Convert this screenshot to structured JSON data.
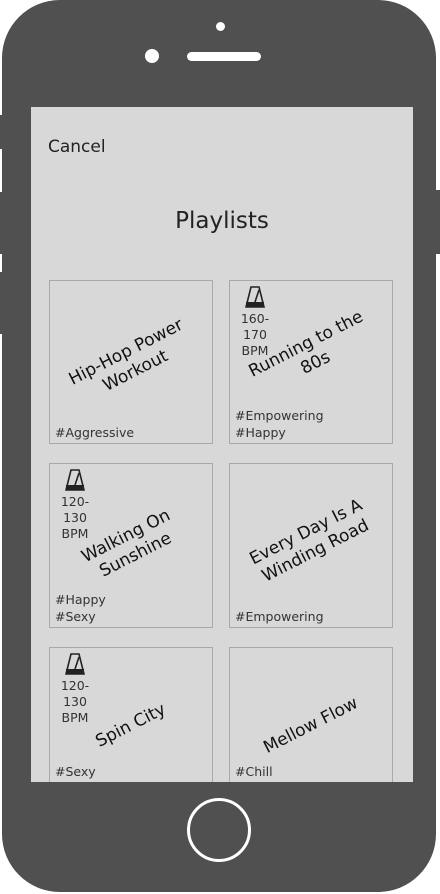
{
  "header": {
    "cancel_label": "Cancel",
    "title": "Playlists"
  },
  "playlists": [
    {
      "title": "Hip-Hop Power Workout",
      "bpm": "",
      "tags": [
        "#Aggressive"
      ]
    },
    {
      "title": "Running to the 80s",
      "bpm": "160-170 BPM",
      "tags": [
        "#Empowering",
        "#Happy"
      ]
    },
    {
      "title": "Walking On Sunshine",
      "bpm": "120-130 BPM",
      "tags": [
        "#Happy",
        "#Sexy"
      ]
    },
    {
      "title": "Every Day Is A Winding Road",
      "bpm": "",
      "tags": [
        "#Empowering"
      ]
    },
    {
      "title": "Spin City",
      "bpm": "120-130 BPM",
      "tags": [
        "#Sexy"
      ]
    },
    {
      "title": "Mellow Flow",
      "bpm": "",
      "tags": [
        "#Chill"
      ]
    }
  ],
  "icons": {
    "bpm_icon": "metronome-icon"
  },
  "colors": {
    "phone_frame": "#505050",
    "screen_bg": "#d8d8d8",
    "card_border": "#a9a9a9"
  }
}
